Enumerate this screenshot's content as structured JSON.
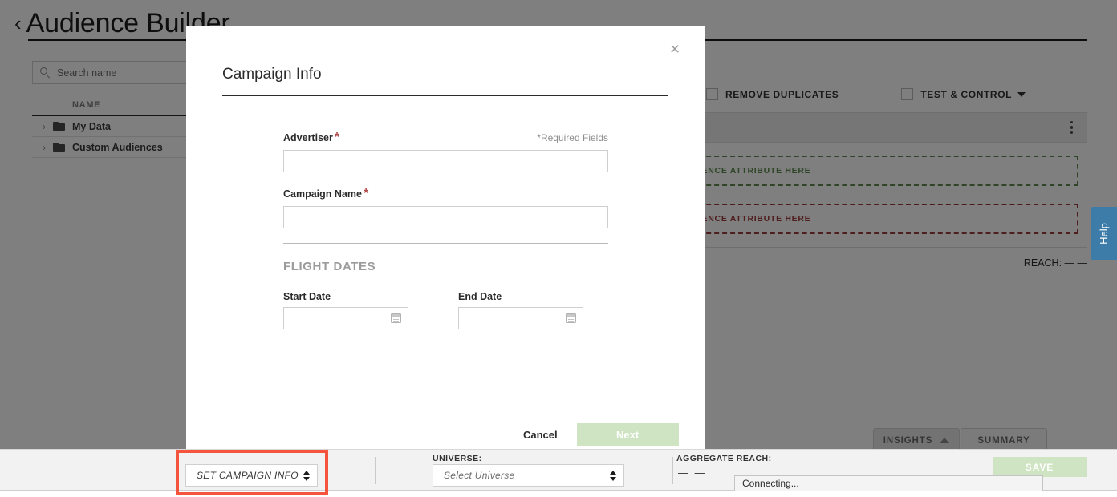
{
  "page": {
    "title": "Audience Builder",
    "back_chevron": "‹"
  },
  "sidebar": {
    "search": {
      "placeholder": "Search name",
      "icon": "search-icon"
    },
    "column_header": "NAME",
    "items": [
      {
        "label": "My Data",
        "chevron": "›",
        "icon": "folder-icon"
      },
      {
        "label": "Custom Audiences",
        "chevron": "›",
        "icon": "folder-icon"
      }
    ]
  },
  "options_bar": {
    "remove_duplicates": "REMOVE DUPLICATES",
    "test_and_control": "TEST & CONTROL"
  },
  "builder": {
    "include_dropzone": "SEARCH OR DROP AUDIENCE ATTRIBUTE HERE",
    "exclude_dropzone": "SEARCH OR DROP AUDIENCE ATTRIBUTE HERE",
    "reach": "REACH: — —",
    "include_color": "#5c8a4e",
    "exclude_color": "#9c3b3b"
  },
  "tabs": {
    "insights": "INSIGHTS",
    "summary": "SUMMARY"
  },
  "help_tab": {
    "label": "Help",
    "color": "#3d7ca8"
  },
  "modal": {
    "title": "Campaign Info",
    "close_icon": "×",
    "required_note": "*Required Fields",
    "fields": {
      "advertiser": {
        "label": "Advertiser",
        "required": "*",
        "value": ""
      },
      "campaign_name": {
        "label": "Campaign Name",
        "required": "*",
        "value": ""
      }
    },
    "flight_dates": {
      "section_title": "FLIGHT DATES",
      "start": {
        "label": "Start Date",
        "value": "",
        "icon": "calendar-icon"
      },
      "end": {
        "label": "End Date",
        "value": "",
        "icon": "calendar-icon"
      }
    },
    "actions": {
      "cancel": "Cancel",
      "next": "Next",
      "next_color": "#cfe4c2"
    }
  },
  "bottom_bar": {
    "campaign_select": {
      "value": "SET CAMPAIGN INFO",
      "highlight_color": "#f5543d"
    },
    "universe": {
      "label": "UNIVERSE:",
      "placeholder": "Select Universe"
    },
    "aggregate_reach": {
      "label": "AGGREGATE REACH:",
      "value": "— —"
    },
    "save": {
      "label": "SAVE",
      "color": "#cfe4c2"
    },
    "status": "Connecting..."
  }
}
